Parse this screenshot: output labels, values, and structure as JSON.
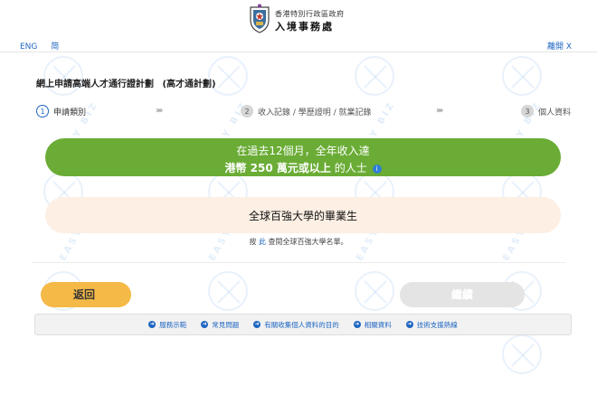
{
  "header": {
    "dept_line1": "香港特別行政區政府",
    "dept_name": "入境事務處",
    "lang_eng": "ENG",
    "lang_simplified": "简",
    "leave_label": "離開 X"
  },
  "page_title": "網上申請高端人才通行證計劃",
  "page_title_sub": "(高才通計劃)",
  "steps": [
    {
      "num": "1",
      "label": "申請類別"
    },
    {
      "num": "2",
      "label": "收入記錄 / 學歷證明 / 就業記錄"
    },
    {
      "num": "3",
      "label": "個人資料"
    }
  ],
  "chevrons": "›››",
  "green_banner": {
    "line1": "在過去12個月，全年收入達",
    "line2_bold": "港幣 250 萬元或以上",
    "line2_rest": " 的人士",
    "info_icon": "i"
  },
  "peach_banner": "全球百強大學的畢業生",
  "note": {
    "prefix": "按 ",
    "link": "此",
    "suffix": " 查閱全球百強大學名單。"
  },
  "buttons": {
    "back": "返回",
    "next": "繼續"
  },
  "footer_links": [
    "服務示範",
    "常見問題",
    "有關收集個人資料的目的",
    "相關資料",
    "技術支援熱線"
  ],
  "watermark": "EASY BIZ",
  "colors": {
    "green": "#6aac35",
    "peach": "#fdefe4",
    "orange": "#f5b947",
    "link_blue": "#1f66c1",
    "disabled": "#e4e4e4"
  }
}
